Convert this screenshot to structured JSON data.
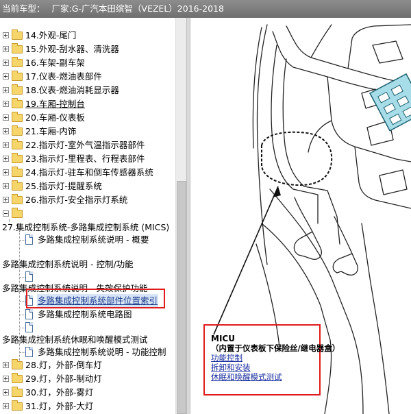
{
  "window": {
    "title_label": "当前车型：",
    "title_model": "厂家:G-广汽本田缤智（VEZEL）2016-2018"
  },
  "tree": {
    "items": [
      {
        "label": "14.外观-尾门"
      },
      {
        "label": "15.外观-刮水器、清洗器"
      },
      {
        "label": "16.车架-副车架"
      },
      {
        "label": "17.仪表-燃油表部件"
      },
      {
        "label": "18.仪表-燃油消耗显示器"
      },
      {
        "label": "19.车厢-控制台"
      },
      {
        "label": "20.车厢-仪表板"
      },
      {
        "label": "21.车厢-内饰"
      },
      {
        "label": "22.指示灯-室外气温指示器部件"
      },
      {
        "label": "23.指示灯-里程表、行程表部件"
      },
      {
        "label": "24.指示灯-驻车和倒车传感器系统"
      },
      {
        "label": "25.指示灯-提醒系统"
      },
      {
        "label": "26.指示灯-安全指示灯系统"
      },
      {
        "label": ""
      },
      {
        "label": "27.集成控制系统-多路集成控制系统 (MICS)"
      },
      {
        "label": "多路集成控制系统说明 - 概要"
      },
      {
        "label": "多路集成控制系统说明 - 控制/功能"
      },
      {
        "label": ""
      },
      {
        "label": "多路集成控制系统说明 - 失效保护功能"
      },
      {
        "label": "多路集成控制系统部件位置索引"
      },
      {
        "label": "多路集成控制系统电路图"
      },
      {
        "label": ""
      },
      {
        "label": "多路集成控制系统休眠和唤醒模式测试"
      },
      {
        "label": "多路集成控制系统说明 - 功能控制"
      },
      {
        "label": "28.灯，外部-倒车灯"
      },
      {
        "label": "29.灯，外部-制动灯"
      },
      {
        "label": "30.灯，外部-雾灯"
      },
      {
        "label": "31.灯，外部-大灯"
      }
    ]
  },
  "callout": {
    "title": "MICU",
    "subtitle": "（内置于仪表板下保险丝/继电器盒）",
    "links": [
      "功能控制",
      "拆卸和安装",
      "休眠和唤醒模式测试"
    ]
  },
  "colors": {
    "titlebar": "#7a7a7a",
    "highlight_box": "#e01b1b",
    "link": "#1a2fa0",
    "selection": "#d6e4f7"
  },
  "icons": {
    "folder": "folder-icon",
    "document": "document-icon",
    "expand": "expand-plus-icon",
    "collapse": "collapse-minus-icon"
  }
}
